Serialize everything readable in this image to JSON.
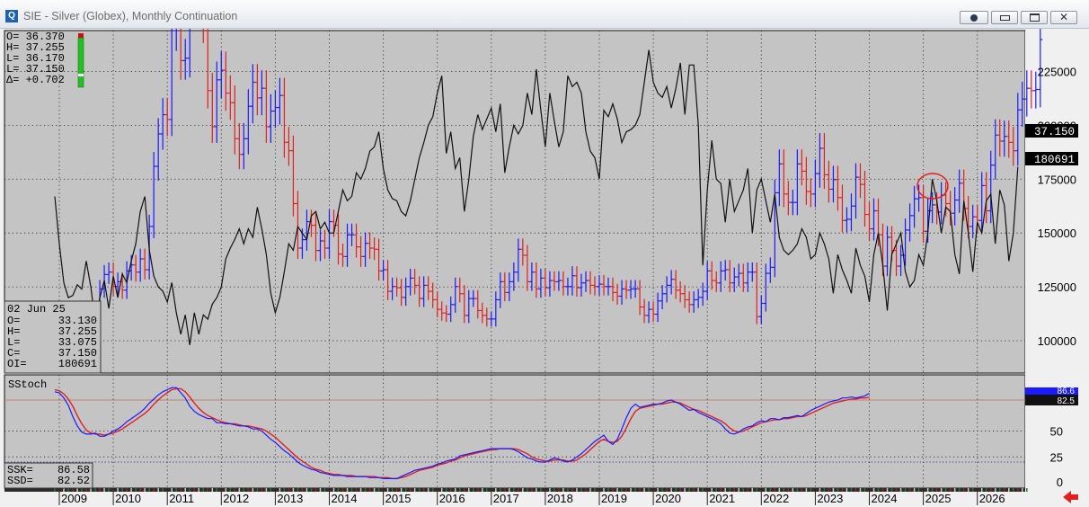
{
  "window": {
    "title": "SIE - Silver (Globex), Monthly Continuation",
    "app_icon_letter": "Q"
  },
  "ohlc_summary": {
    "rows": [
      "O= 36.370",
      "H= 37.255",
      "L= 36.170",
      "L= 37.150",
      "Δ= +0.702"
    ]
  },
  "data_window": {
    "date": "02 Jun 25",
    "rows": [
      {
        "k": "O=",
        "v": "33.130"
      },
      {
        "k": "H=",
        "v": "37.255"
      },
      {
        "k": "L=",
        "v": "33.075"
      },
      {
        "k": "C=",
        "v": "37.150"
      },
      {
        "k": "OI=",
        "v": "180691"
      }
    ]
  },
  "stoch_readout": {
    "rows": [
      {
        "k": "SSK=",
        "v": "86.58"
      },
      {
        "k": "SSD=",
        "v": "82.52"
      }
    ]
  },
  "chart_data": [
    {
      "type": "ohlc+line",
      "title": "SIE - Silver (Globex), Monthly Continuation",
      "x_ticks": [
        "2009",
        "2010",
        "2011",
        "2012",
        "2013",
        "2014",
        "2015",
        "2016",
        "2017",
        "2018",
        "2019",
        "2020",
        "2021",
        "2022",
        "2023",
        "2024",
        "2025",
        "2026"
      ],
      "right_axis_labels": [
        "225000",
        "200000",
        "175000",
        "150000",
        "125000",
        "100000"
      ],
      "right_axis_values": [
        225000,
        200000,
        175000,
        150000,
        125000,
        100000
      ],
      "right_axis_range": [
        85000,
        244000
      ],
      "price_scale_range": [
        9.4,
        37.9
      ],
      "last_price_label": "37.150",
      "last_oi_label": "180691",
      "colors": {
        "up": "#1a1aff",
        "down": "#e0201e",
        "open_interest": "#111111",
        "highlight_circle": "#e0201e"
      },
      "grid": true,
      "series": [
        {
          "name": "Open Interest",
          "start": "2008-12",
          "values": [
            167000,
            145000,
            127000,
            120000,
            121000,
            126000,
            124000,
            137000,
            125000,
            108000,
            120000,
            128000,
            115000,
            130000,
            120000,
            131000,
            127000,
            137000,
            145000,
            160000,
            167000,
            142000,
            130000,
            125000,
            123000,
            118000,
            127000,
            113000,
            103000,
            112000,
            98000,
            113000,
            103000,
            112000,
            110000,
            117000,
            120000,
            125000,
            138000,
            143000,
            147000,
            152000,
            145000,
            152000,
            148000,
            162000,
            152000,
            140000,
            122000,
            113000,
            120000,
            132000,
            145000,
            142000,
            153000,
            150000,
            147000,
            158000,
            160000,
            152000,
            155000,
            150000,
            150000,
            160000,
            170000,
            165000,
            167000,
            178000,
            175000,
            180000,
            188000,
            190000,
            197000,
            180000,
            170000,
            166000,
            165000,
            160000,
            158000,
            165000,
            175000,
            185000,
            192000,
            200000,
            204000,
            215000,
            223000,
            187000,
            197000,
            180000,
            185000,
            160000,
            175000,
            195000,
            205000,
            198000,
            203000,
            208000,
            197000,
            210000,
            178000,
            190000,
            200000,
            196000,
            200000,
            215000,
            205000,
            226000,
            207000,
            190000,
            215000,
            202000,
            190000,
            197000,
            223000,
            218000,
            220000,
            215000,
            197000,
            188000,
            185000,
            175000,
            207000,
            204000,
            210000,
            203000,
            192000,
            197000,
            198000,
            200000,
            205000,
            220000,
            235000,
            220000,
            215000,
            213000,
            218000,
            208000,
            217000,
            229000,
            205000,
            228000,
            228000,
            200000,
            135000,
            170000,
            193000,
            175000,
            173000,
            155000,
            175000,
            160000,
            165000,
            170000,
            180000,
            150000,
            170000,
            175000,
            165000,
            155000,
            168000,
            148000,
            142000,
            140000,
            142000,
            145000,
            152000,
            148000,
            138000,
            140000,
            150000,
            145000,
            138000,
            122000,
            140000,
            133000,
            128000,
            122000,
            143000,
            135000,
            130000,
            118000,
            140000,
            150000,
            135000,
            114000,
            140000,
            145000,
            150000,
            132000,
            125000,
            128000,
            140000,
            135000,
            150000,
            175000,
            165000,
            150000,
            162000,
            160000,
            140000,
            131000,
            165000,
            150000,
            132000,
            155000,
            150000,
            165000,
            168000,
            145000,
            170000,
            163000,
            137000,
            150000,
            180691
          ]
        },
        {
          "name": "Price",
          "start": "2008-12",
          "close": [
            11.2,
            12.3,
            13.0,
            13.1,
            12.5,
            13.9,
            13.1,
            13.7,
            13.1,
            14.6,
            16.4,
            17.6,
            17.8,
            16.6,
            17.0,
            16.3,
            17.9,
            18.4,
            17.8,
            18.9,
            18.0,
            21.6,
            26.6,
            29.3,
            30.9,
            30.5,
            37.9,
            48.6,
            35.4,
            35.6,
            40.1,
            41.7,
            42.1,
            38.6,
            32.9,
            29.9,
            33.8,
            34.6,
            32.7,
            31.9,
            28.9,
            27.6,
            28.9,
            31.6,
            33.6,
            32.3,
            33.1,
            29.9,
            31.2,
            31.5,
            32.5,
            28.6,
            27.9,
            23.5,
            19.8,
            20.5,
            22.0,
            21.7,
            19.6,
            20.4,
            19.8,
            22.0,
            21.7,
            19.3,
            19.1,
            20.9,
            20.9,
            19.9,
            19.1,
            20.2,
            19.8,
            19.7,
            17.9,
            18.0,
            16.2,
            16.6,
            16.5,
            15.7,
            16.6,
            17.3,
            16.7,
            15.6,
            16.7,
            16.2,
            15.5,
            14.7,
            14.4,
            14.3,
            15.1,
            16.6,
            16.0,
            14.2,
            15.6,
            15.6,
            14.6,
            14.2,
            13.9,
            13.9,
            15.5,
            17.0,
            16.1,
            17.0,
            17.8,
            19.7,
            19.2,
            17.0,
            17.8,
            16.4,
            17.3,
            16.5,
            17.1,
            17.0,
            17.1,
            16.6,
            16.6,
            17.5,
            16.5,
            16.9,
            17.1,
            16.7,
            16.6,
            16.8,
            16.6,
            16.6,
            16.1,
            15.8,
            16.4,
            16.3,
            16.4,
            16.4,
            14.9,
            14.2,
            14.7,
            14.3,
            15.4,
            16.0,
            16.7,
            17.2,
            16.3,
            16.0,
            15.5,
            15.1,
            15.5,
            15.7,
            16.2,
            17.9,
            17.1,
            16.9,
            17.9,
            18.0,
            16.9,
            17.4,
            17.7,
            16.9,
            17.8,
            17.8,
            14.1,
            15.2,
            17.7,
            18.2,
            24.4,
            26.8,
            24.3,
            23.6,
            23.6,
            26.8,
            26.2,
            24.5,
            24.3,
            26.0,
            28.1,
            25.9,
            24.7,
            25.5,
            24.0,
            22.1,
            22.2,
            23.3,
            25.7,
            25.1,
            22.6,
            21.4,
            22.9,
            20.9,
            18.3,
            20.7,
            19.6,
            18.3,
            19.2,
            21.3,
            22.5,
            23.9,
            24.0,
            21.2,
            22.9,
            23.4,
            22.8,
            24.2,
            23.5,
            22.7,
            23.8,
            25.2,
            23.1,
            21.6,
            22.4,
            22.1,
            25.0,
            22.9,
            26.7,
            29.2,
            28.7,
            29.1,
            28.6,
            27.9,
            31.3,
            32.2,
            33.1,
            32.9,
            33.0,
            37.15
          ]
        }
      ]
    },
    {
      "type": "line",
      "title": "SStoch",
      "y_ticks": [
        "80",
        "50",
        "25",
        "0"
      ],
      "y_values": [
        80,
        50,
        25,
        0
      ],
      "ylim": [
        0,
        100
      ],
      "value_labels": [
        "86.6",
        "82.5"
      ],
      "reference_line": 80,
      "colors": {
        "ssk": "#1a1aff",
        "ssd": "#e0201e",
        "reference": "#c08070"
      },
      "series": [
        {
          "name": "SSK",
          "start": "2008-12",
          "values": [
            88,
            87,
            82,
            75,
            64,
            55,
            49,
            47,
            47,
            48,
            45,
            45,
            47,
            50,
            52,
            55,
            59,
            62,
            65,
            68,
            72,
            77,
            81,
            85,
            88,
            90,
            92,
            92,
            87,
            82,
            74,
            69,
            66,
            64,
            62,
            62,
            58,
            58,
            57,
            57,
            56,
            55,
            55,
            54,
            52,
            52,
            50,
            46,
            42,
            39,
            35,
            31,
            28,
            24,
            20,
            17,
            15,
            13,
            12,
            10,
            9,
            8,
            7,
            7,
            7,
            6,
            6,
            6,
            6,
            6,
            5,
            5,
            5,
            4,
            4,
            4,
            4,
            6,
            8,
            10,
            12,
            13,
            14,
            15,
            16,
            18,
            19,
            21,
            22,
            23,
            26,
            27,
            28,
            29,
            30,
            31,
            32,
            33,
            33,
            33,
            33,
            33,
            32,
            30,
            27,
            24,
            23,
            21,
            20,
            20,
            22,
            24,
            23,
            21,
            20,
            22,
            25,
            28,
            32,
            36,
            40,
            43,
            46,
            40,
            37,
            42,
            52,
            63,
            72,
            76,
            73,
            74,
            75,
            76,
            76,
            77,
            79,
            80,
            78,
            76,
            73,
            70,
            71,
            68,
            66,
            64,
            62,
            60,
            57,
            52,
            48,
            47,
            49,
            52,
            54,
            55,
            58,
            60,
            59,
            62,
            62,
            61,
            63,
            63,
            64,
            65,
            64,
            67,
            70,
            72,
            74,
            76,
            78,
            79,
            80,
            82,
            82,
            83,
            82,
            83,
            84,
            86.58
          ]
        },
        {
          "name": "SSD",
          "start": "2008-12",
          "values": [
            90,
            89,
            86,
            81,
            74,
            65,
            57,
            51,
            48,
            47,
            47,
            46,
            47,
            48,
            50,
            52,
            55,
            58,
            61,
            64,
            67,
            71,
            76,
            80,
            84,
            87,
            90,
            91,
            91,
            88,
            83,
            77,
            72,
            68,
            65,
            63,
            61,
            59,
            58,
            57,
            57,
            56,
            55,
            55,
            54,
            53,
            52,
            50,
            47,
            44,
            40,
            36,
            32,
            28,
            24,
            21,
            18,
            15,
            13,
            12,
            10,
            9,
            8,
            8,
            7,
            7,
            7,
            6,
            6,
            6,
            6,
            6,
            5,
            5,
            5,
            4,
            4,
            5,
            6,
            8,
            10,
            12,
            13,
            14,
            15,
            17,
            18,
            19,
            21,
            22,
            24,
            26,
            27,
            28,
            29,
            30,
            31,
            32,
            32,
            33,
            33,
            33,
            33,
            32,
            30,
            28,
            25,
            23,
            22,
            21,
            21,
            22,
            22,
            22,
            21,
            21,
            22,
            25,
            28,
            32,
            36,
            40,
            42,
            40,
            39,
            40,
            45,
            53,
            62,
            69,
            72,
            73,
            74,
            75,
            76,
            76,
            77,
            78,
            78,
            77,
            75,
            73,
            71,
            70,
            68,
            66,
            64,
            62,
            60,
            57,
            53,
            50,
            49,
            50,
            52,
            54,
            56,
            58,
            59,
            60,
            61,
            61,
            62,
            62,
            63,
            64,
            64,
            65,
            67,
            69,
            71,
            73,
            75,
            77,
            78,
            79,
            80,
            81,
            81,
            82,
            82,
            82.52
          ]
        }
      ]
    }
  ]
}
